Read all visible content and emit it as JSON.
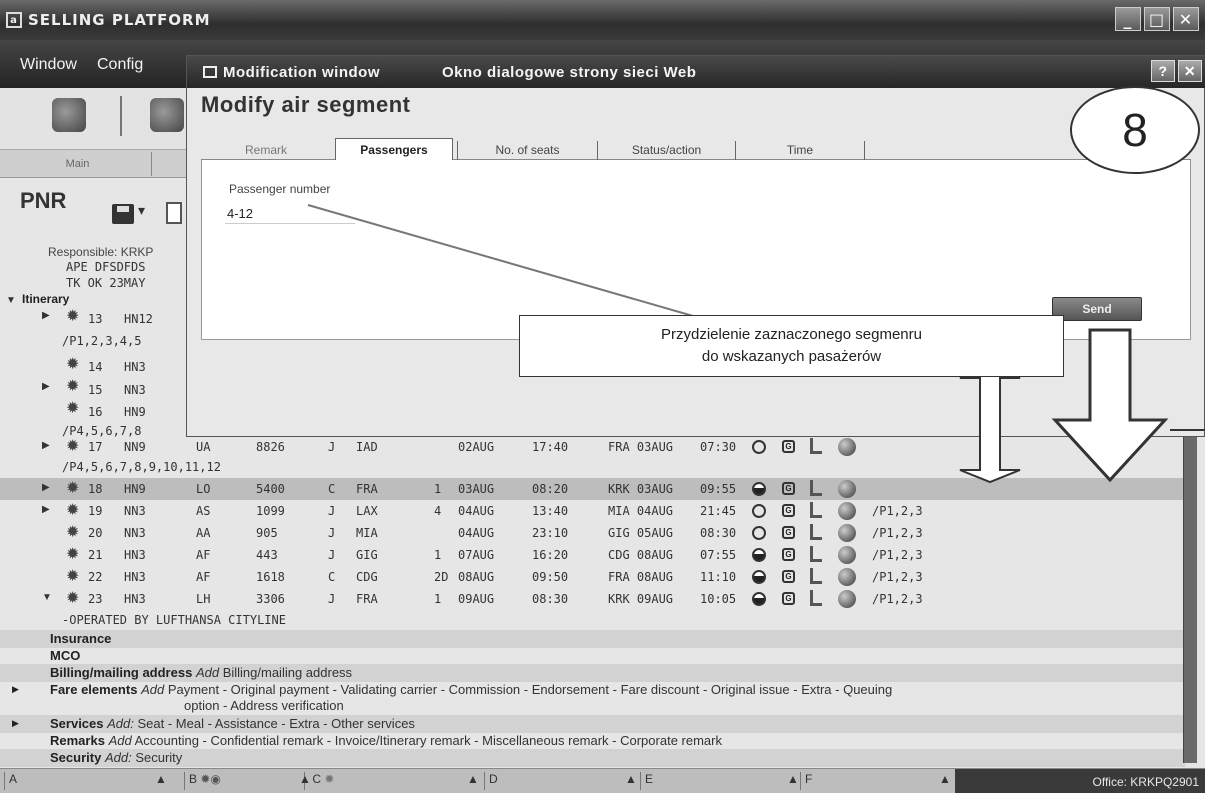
{
  "window": {
    "title": "SELLING PLATFORM",
    "icon_glyph": "a",
    "controls": [
      "_",
      "□",
      "✕"
    ]
  },
  "menu": {
    "items": [
      "Window",
      "Config"
    ]
  },
  "tabs": {
    "main": "Main"
  },
  "pnr": {
    "title": "PNR",
    "save_drop": "▾",
    "responsible": "Responsible: KRKP",
    "header_lines": [
      "APE DFSDFDS",
      "TK OK 23MAY"
    ],
    "itinerary_label": "Itinerary",
    "segments_partial": [
      {
        "num": "13",
        "status": "HN12"
      },
      {
        "sub": "/P1,2,3,4,5"
      },
      {
        "num": "14",
        "status": "HN3"
      },
      {
        "num": "15",
        "status": "NN3"
      },
      {
        "num": "16",
        "status": "HN9"
      },
      {
        "sub": "/P4,5,6,7,8"
      }
    ],
    "segments": [
      {
        "num": "17",
        "status": "NN9",
        "airline": "UA",
        "flight": "8826",
        "cls": "J",
        "from": "IAD",
        "term": "",
        "dep_date": "02AUG",
        "dep_time": "17:40",
        "arr": "FRA 03AUG",
        "arr_time": "07:30",
        "pax": ""
      },
      {
        "num": "18",
        "status": "HN9",
        "airline": "LO",
        "flight": "5400",
        "cls": "C",
        "from": "FRA",
        "term": "1",
        "dep_date": "03AUG",
        "dep_time": "08:20",
        "arr": "KRK 03AUG",
        "arr_time": "09:55",
        "pax": ""
      },
      {
        "num": "19",
        "status": "NN3",
        "airline": "AS",
        "flight": "1099",
        "cls": "J",
        "from": "LAX",
        "term": "4",
        "dep_date": "04AUG",
        "dep_time": "13:40",
        "arr": "MIA 04AUG",
        "arr_time": "21:45",
        "pax": "/P1,2,3"
      },
      {
        "num": "20",
        "status": "NN3",
        "airline": "AA",
        "flight": "905",
        "cls": "J",
        "from": "MIA",
        "term": "",
        "dep_date": "04AUG",
        "dep_time": "23:10",
        "arr": "GIG 05AUG",
        "arr_time": "08:30",
        "pax": "/P1,2,3"
      },
      {
        "num": "21",
        "status": "HN3",
        "airline": "AF",
        "flight": "443",
        "cls": "J",
        "from": "GIG",
        "term": "1",
        "dep_date": "07AUG",
        "dep_time": "16:20",
        "arr": "CDG 08AUG",
        "arr_time": "07:55",
        "pax": "/P1,2,3"
      },
      {
        "num": "22",
        "status": "HN3",
        "airline": "AF",
        "flight": "1618",
        "cls": "C",
        "from": "CDG",
        "term": "2D",
        "dep_date": "08AUG",
        "dep_time": "09:50",
        "arr": "FRA 08AUG",
        "arr_time": "11:10",
        "pax": "/P1,2,3"
      },
      {
        "num": "23",
        "status": "HN3",
        "airline": "LH",
        "flight": "3306",
        "cls": "J",
        "from": "FRA",
        "term": "1",
        "dep_date": "09AUG",
        "dep_time": "08:30",
        "arr": "KRK 09AUG",
        "arr_time": "10:05",
        "pax": "/P1,2,3"
      }
    ],
    "seg17_sub": "/P4,5,6,7,8,9,10,11,12",
    "operated_by": "-OPERATED BY LUFTHANSA CITYLINE",
    "sections": {
      "insurance": "Insurance",
      "mco": "MCO",
      "billing": {
        "label": "Billing/mailing address",
        "add": "Add",
        "links": "Billing/mailing address"
      },
      "fare": {
        "label": "Fare elements",
        "add": "Add",
        "links": "Payment - Original payment - Validating carrier - Commission - Endorsement - Fare discount - Original issue - Extra - Queuing",
        "links2": "option - Address verification"
      },
      "services": {
        "label": "Services",
        "add": "Add:",
        "links": "Seat - Meal - Assistance - Extra - Other services"
      },
      "remarks": {
        "label": "Remarks",
        "add": "Add",
        "links": "Accounting - Confidential remark - Invoice/Itinerary remark - Miscellaneous remark - Corporate remark"
      },
      "security": {
        "label": "Security",
        "add": "Add:",
        "links": "Security"
      }
    }
  },
  "statusbar": {
    "cells": [
      "A",
      "B",
      "C",
      "D",
      "E",
      "F"
    ],
    "office": "Office: KRKPQ2901"
  },
  "dialog": {
    "title": "Modification window",
    "subtitle": "Okno dialogowe strony sieci Web",
    "controls": [
      "?",
      "✕"
    ],
    "heading": "Modify air segment",
    "tabs": [
      "Remark",
      "Passengers",
      "No. of seats",
      "Status/action",
      "Time"
    ],
    "active_tab": "Passengers",
    "field_label": "Passenger number",
    "field_value": "4-12",
    "send_label": "Send"
  },
  "annotation": {
    "badge": "8",
    "callout_line1": "Przydzielenie zaznaczonego segmenru",
    "callout_line2": "do wskazanych pasażerów"
  }
}
